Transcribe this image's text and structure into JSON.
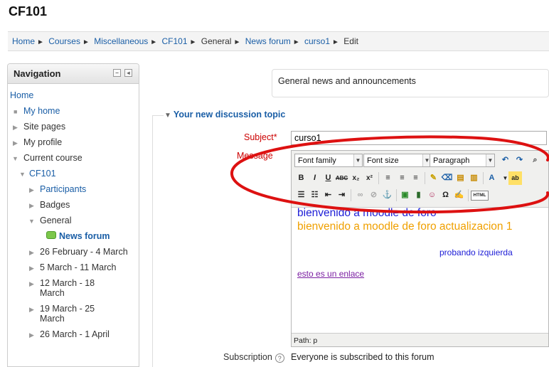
{
  "page_title": "CF101",
  "breadcrumb": [
    {
      "label": "Home",
      "link": true
    },
    {
      "label": "Courses",
      "link": true
    },
    {
      "label": "Miscellaneous",
      "link": true
    },
    {
      "label": "CF101",
      "link": true
    },
    {
      "label": "General",
      "link": false
    },
    {
      "label": "News forum",
      "link": true
    },
    {
      "label": "curso1",
      "link": true
    },
    {
      "label": "Edit",
      "link": false
    }
  ],
  "breadcrumb_sep": "►",
  "navigation": {
    "title": "Navigation",
    "items": [
      {
        "label": "Home"
      },
      {
        "label": "My home"
      },
      {
        "label": "Site pages"
      },
      {
        "label": "My profile"
      },
      {
        "label": "Current course"
      },
      {
        "label": "CF101"
      },
      {
        "label": "Participants"
      },
      {
        "label": "Badges"
      },
      {
        "label": "General"
      },
      {
        "label": "News forum"
      },
      {
        "label": "26 February - 4 March"
      },
      {
        "label": "5 March - 11 March"
      },
      {
        "label": "12 March - 18 March"
      },
      {
        "label": "19 March - 25 March"
      },
      {
        "label": "26 March - 1 April"
      }
    ]
  },
  "intro_text": "General news and announcements",
  "form": {
    "legend": "Your new discussion topic",
    "subject_label": "Subject",
    "required_mark": "*",
    "subject_value": "curso1",
    "message_label": "Message",
    "subscription_label": "Subscription",
    "subscription_value": "Everyone is subscribed to this forum"
  },
  "editor": {
    "font_family": "Font family",
    "font_size": "Font size",
    "format": "Paragraph",
    "lines": [
      "bienvenido a moodle de foro",
      "bienvenido a moodle de foro actualizacion 1",
      "probando izquierda",
      "esto es un enlace"
    ],
    "path": "Path: p",
    "html_btn": "HTML"
  },
  "colors": {
    "link": "#1a5ea6",
    "required": "#cc0000",
    "annotation_oval": "#dd1111",
    "text_blue": "#1c1cd6",
    "text_orange": "#f0a000",
    "text_link_visited": "#7b1fa2"
  }
}
